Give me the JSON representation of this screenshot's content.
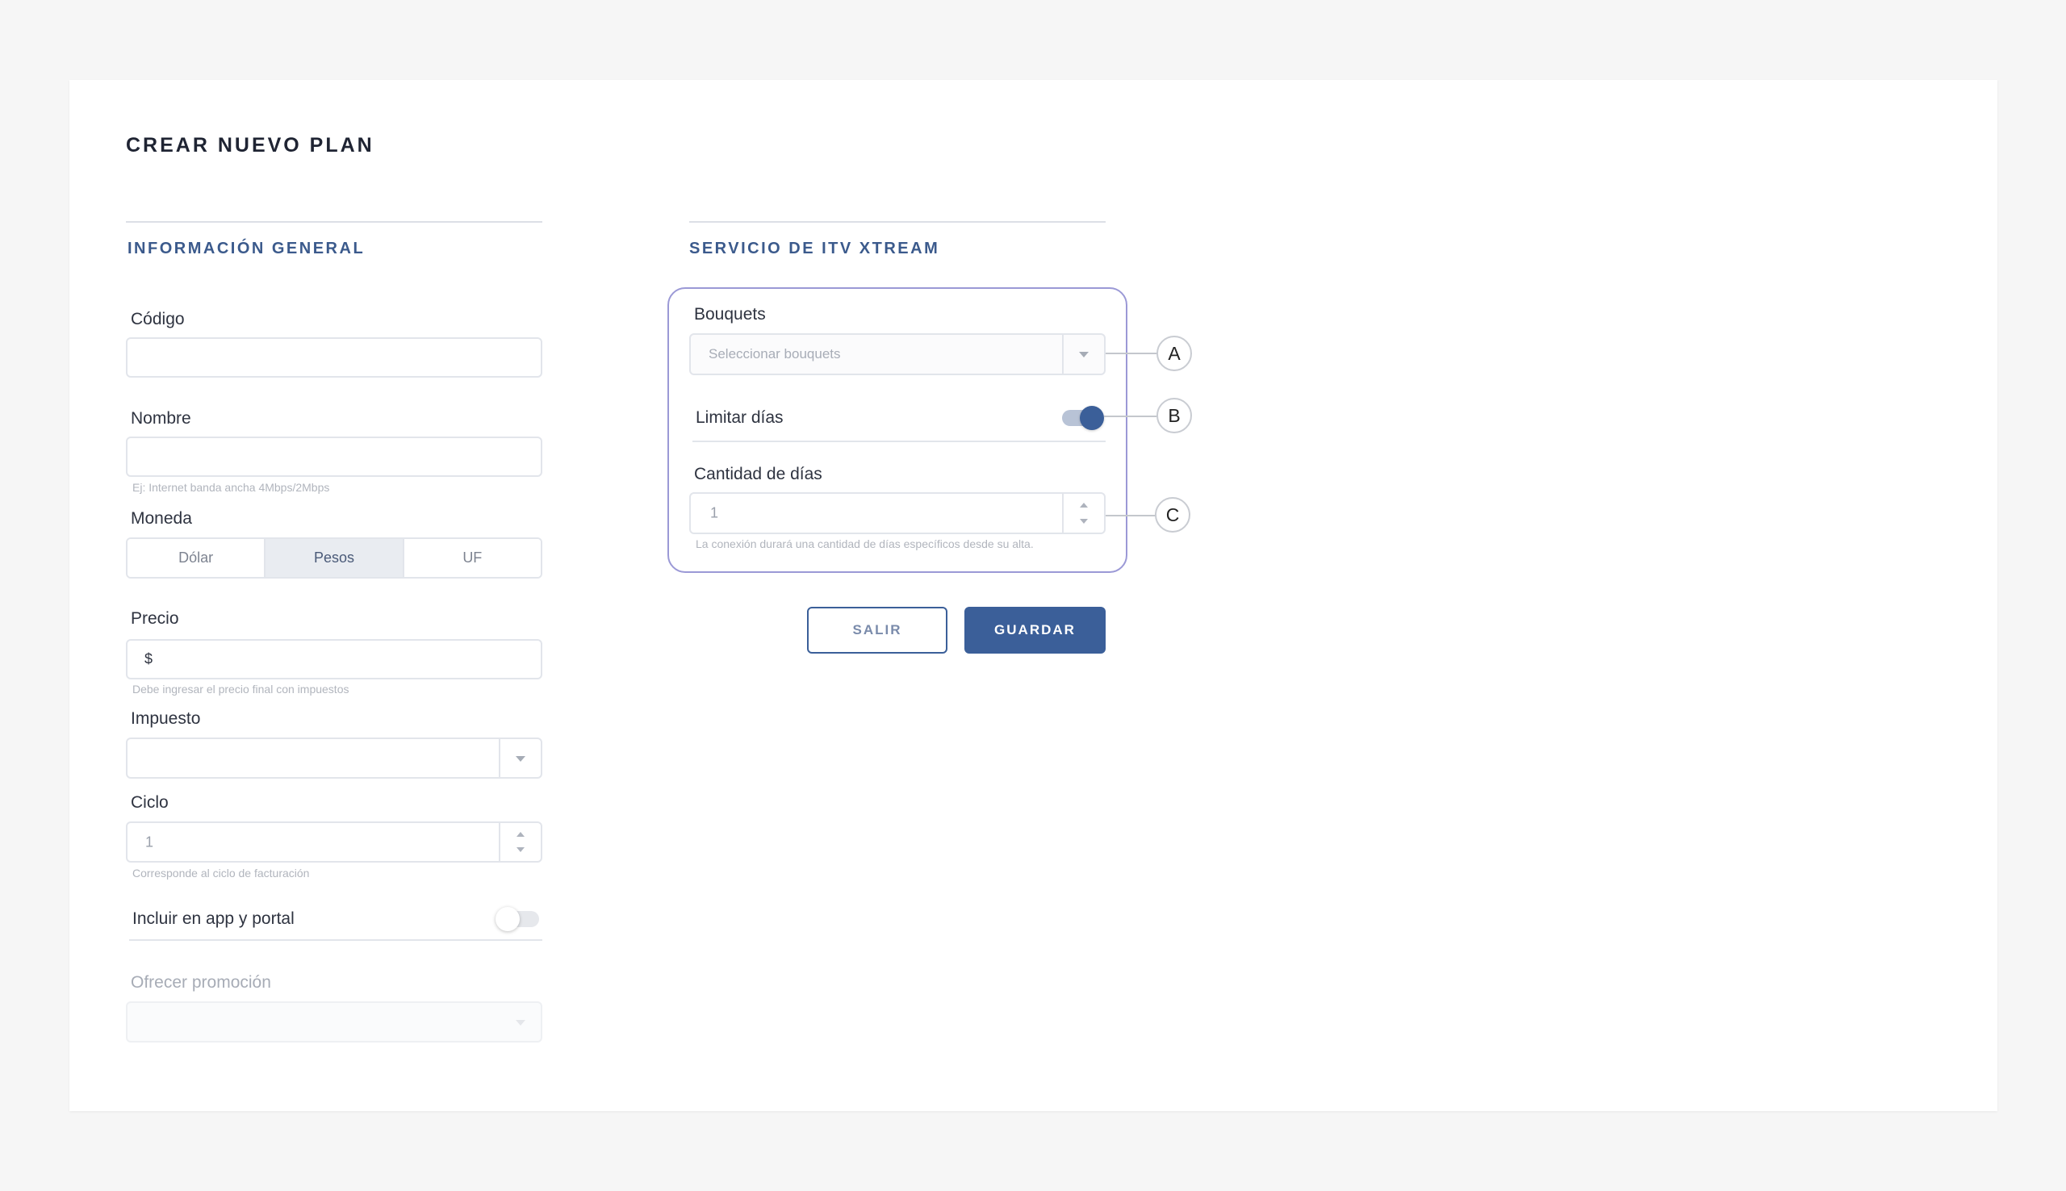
{
  "page": {
    "title": "CREAR NUEVO PLAN"
  },
  "general": {
    "section_title": "INFORMACIÓN GENERAL",
    "codigo": {
      "label": "Código",
      "value": ""
    },
    "nombre": {
      "label": "Nombre",
      "value": "",
      "helper": "Ej: Internet banda ancha 4Mbps/2Mbps"
    },
    "moneda": {
      "label": "Moneda",
      "options": [
        "Dólar",
        "Pesos",
        "UF"
      ],
      "selected": "Pesos"
    },
    "precio": {
      "label": "Precio",
      "prefix": "$",
      "helper": "Debe ingresar el precio final con impuestos"
    },
    "impuesto": {
      "label": "Impuesto",
      "value": ""
    },
    "ciclo": {
      "label": "Ciclo",
      "value": "1",
      "helper": "Corresponde al ciclo de facturación"
    },
    "incluir_app": {
      "label": "Incluir en app y portal",
      "enabled": false
    },
    "promocion": {
      "label": "Ofrecer promoción",
      "disabled": true,
      "value": ""
    }
  },
  "itv": {
    "section_title": "SERVICIO DE ITV XTREAM",
    "bouquets": {
      "label": "Bouquets",
      "placeholder": "Seleccionar bouquets"
    },
    "limitar_dias": {
      "label": "Limitar días",
      "enabled": true
    },
    "cantidad_dias": {
      "label": "Cantidad de días",
      "value": "1",
      "helper": "La conexión durará una cantidad de días específicos desde su alta."
    }
  },
  "callouts": [
    "A",
    "B",
    "C"
  ],
  "actions": {
    "exit_label": "SALIR",
    "save_label": "GUARDAR"
  },
  "colors": {
    "accent": "#3b5f99",
    "highlight_frame": "#9b99d6",
    "section_title": "#3b5a8c"
  }
}
